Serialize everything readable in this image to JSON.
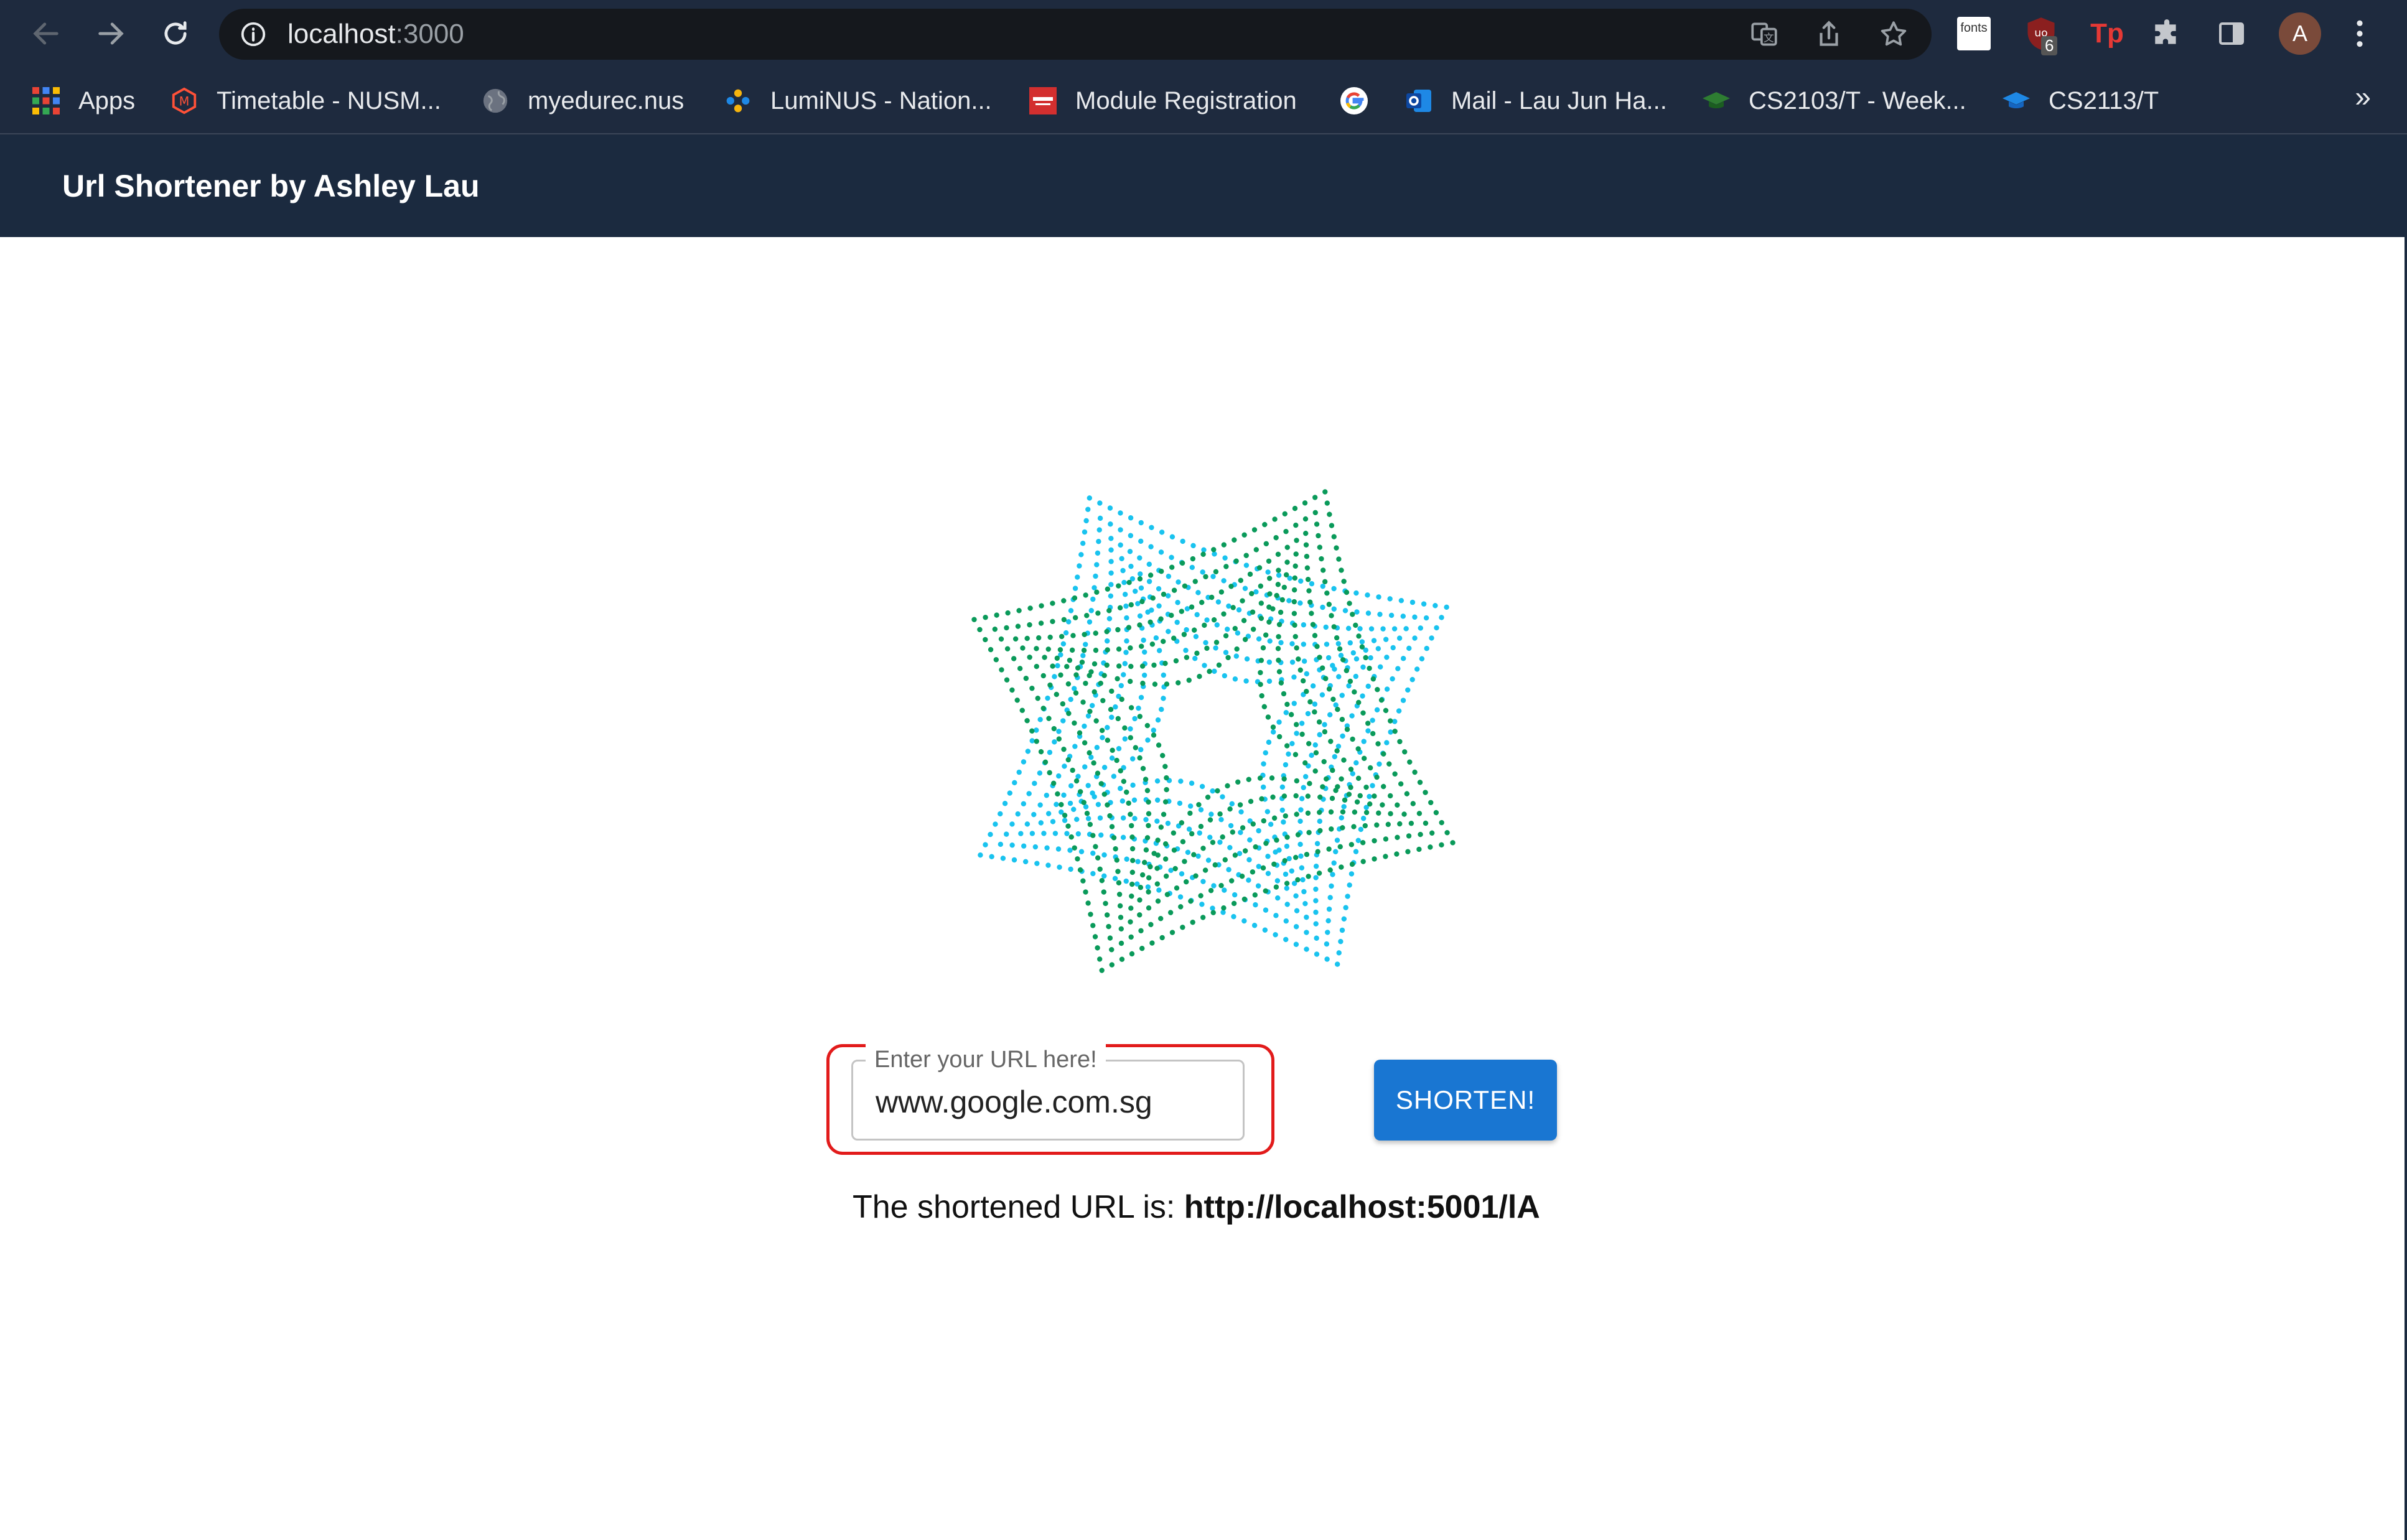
{
  "browser": {
    "url_host": "localhost",
    "url_port": ":3000",
    "profile_initial": "A",
    "ext_fonts_label": "fonts",
    "ext_ublock_badge": "6",
    "ext_tp_label": "Tp",
    "icons": {
      "back": "arrow-left-icon",
      "forward": "arrow-right-icon",
      "reload": "reload-icon",
      "site_info": "info-icon",
      "translate": "translate-icon",
      "share": "share-icon",
      "bookmark": "star-icon",
      "extensions": "puzzle-icon",
      "side_panel": "side-panel-icon",
      "menu": "kebab-menu-icon"
    }
  },
  "bookmarks": [
    {
      "label": "Apps"
    },
    {
      "label": "Timetable - NUSM..."
    },
    {
      "label": "myedurec.nus"
    },
    {
      "label": "LumiNUS - Nation..."
    },
    {
      "label": "Module Registration"
    },
    {
      "label": ""
    },
    {
      "label": "Mail - Lau Jun Ha..."
    },
    {
      "label": "CS2103/T - Week..."
    },
    {
      "label": "CS2113/T"
    }
  ],
  "bookmarks_more": "»",
  "app": {
    "title": "Url Shortener by Ashley Lau"
  },
  "form": {
    "label": "Enter your URL here!",
    "value": "www.google.com.sg",
    "button": "SHORTEN!"
  },
  "result": {
    "prefix": "The shortened URL is: ",
    "url": "http://localhost:5001/lA"
  },
  "colors": {
    "chrome_bg": "#1e2a3e",
    "appbar_bg": "#1b2a3f",
    "button_blue": "#1976d2",
    "focus_red": "#e21b1b",
    "logo_green": "#0a9a5a",
    "logo_cyan": "#19c3ef"
  }
}
